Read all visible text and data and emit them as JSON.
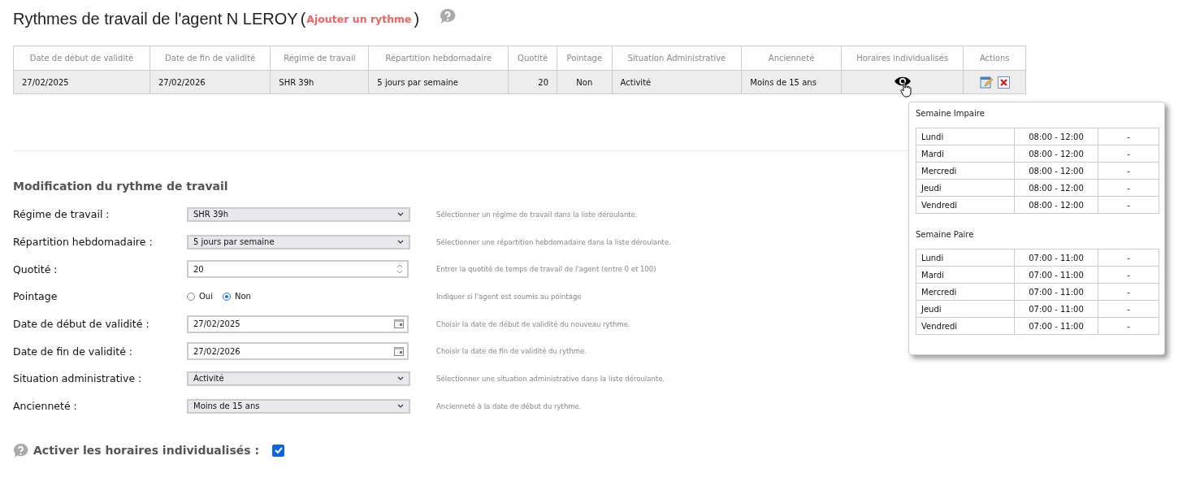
{
  "page_title": {
    "text": "Rythmes de travail de l'agent N LEROY",
    "open_paren": "(",
    "link": "Ajouter un rythme",
    "close_paren": ")"
  },
  "table": {
    "columns": [
      "Date de début de validité",
      "Date de fin de validité",
      "Régime de travail",
      "Répartition hebdomadaire",
      "Quotité",
      "Pointage",
      "Situation Administrative",
      "Ancienneté",
      "Horaires individualisés",
      "Actions"
    ],
    "rows": [
      {
        "cells": [
          "27/02/2025",
          "27/02/2026",
          "SHR 39h",
          "5 jours par semaine",
          "20",
          "Non",
          "Activité",
          "Moins de 15 ans"
        ]
      }
    ]
  },
  "popup": {
    "weeks": [
      {
        "title": "Semaine Impaire",
        "rows": [
          [
            "Lundi",
            "08:00 - 12:00",
            "-"
          ],
          [
            "Mardi",
            "08:00 - 12:00",
            "-"
          ],
          [
            "Mercredi",
            "08:00 - 12:00",
            "-"
          ],
          [
            "Jeudi",
            "08:00 - 12:00",
            "-"
          ],
          [
            "Vendredi",
            "08:00 - 12:00",
            "-"
          ]
        ]
      },
      {
        "title": "Semaine Paire",
        "rows": [
          [
            "Lundi",
            "07:00 - 11:00",
            "-"
          ],
          [
            "Mardi",
            "07:00 - 11:00",
            "-"
          ],
          [
            "Mercredi",
            "07:00 - 11:00",
            "-"
          ],
          [
            "Jeudi",
            "07:00 - 11:00",
            "-"
          ],
          [
            "Vendredi",
            "07:00 - 11:00",
            "-"
          ]
        ]
      }
    ]
  },
  "form": {
    "title": "Modification du rythme de travail",
    "fields": [
      {
        "kind": "select",
        "label": "Régime de travail :",
        "value": "SHR 39h",
        "hint": "Sélectionner un régime de travail dans la liste déroulante."
      },
      {
        "kind": "select",
        "label": "Répartition hebdomadaire :",
        "value": "5 jours par semaine",
        "hint": "Sélectionner une répartition hebdomadaire dans la liste déroulante."
      },
      {
        "kind": "number",
        "label": "Quotité :",
        "value": "20",
        "hint": "Entrer la quotité de temps de travail de l'agent (entre 0 et 100)"
      },
      {
        "kind": "radio",
        "label": "Pointage",
        "options": [
          {
            "label": "Oui",
            "selected": false
          },
          {
            "label": "Non",
            "selected": true
          }
        ],
        "hint": "Indiquer si l'agent est soumis au pointage"
      },
      {
        "kind": "date",
        "label": "Date de début de validité :",
        "value": "27/02/2025",
        "hint": "Choisir la date de début de validité du nouveau rythme."
      },
      {
        "kind": "date",
        "label": "Date de fin de validité :",
        "value": "27/02/2026",
        "hint": "Choisir la date de fin de validité du rythme."
      },
      {
        "kind": "select",
        "label": "Situation administrative :",
        "value": "Activité",
        "hint": "Sélectionner une situation administrative dans la liste déroulante."
      },
      {
        "kind": "select",
        "label": "Ancienneté :",
        "value": "Moins de 15 ans",
        "hint": "Ancienneté à la date de début du rythme."
      }
    ],
    "individual": {
      "label": "Activer les horaires individualisés :",
      "checked": true
    }
  }
}
